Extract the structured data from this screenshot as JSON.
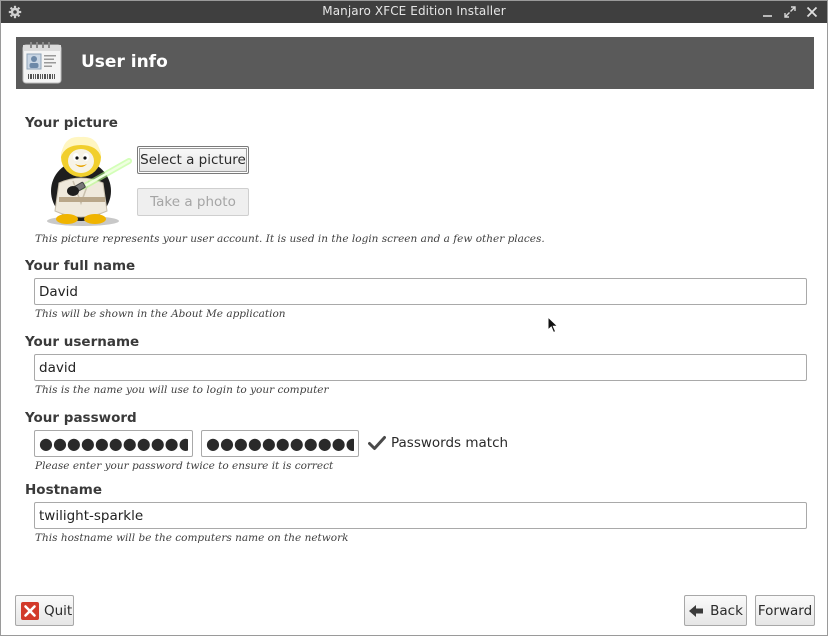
{
  "window": {
    "title": "Manjaro XFCE Edition Installer"
  },
  "header": {
    "title": "User info"
  },
  "picture": {
    "label": "Your picture",
    "select_button": "Select a picture",
    "photo_button": "Take a photo",
    "hint": "This picture represents your user account. It is used in the login screen and a few other places."
  },
  "fullname": {
    "label": "Your full name",
    "value": "David",
    "hint": "This will be shown in the About Me application"
  },
  "username": {
    "label": "Your username",
    "value": "david",
    "hint": "This is the name you will use to login to your computer"
  },
  "password": {
    "label": "Your password",
    "value1": "●●●●●●●●●●●",
    "value2": "●●●●●●●●●●●",
    "match_text": "Passwords match",
    "hint": "Please enter your password twice to ensure it is correct"
  },
  "hostname": {
    "label": "Hostname",
    "value": "twilight-sparkle",
    "hint": "This hostname will be the computers name on the network"
  },
  "footer": {
    "quit_label": "Quit",
    "back_label": "Back",
    "forward_label": "Forward"
  },
  "colors": {
    "titlebar": "#3f3f3f",
    "header": "#5a5a5a",
    "quit_icon": "#d23a2a"
  }
}
